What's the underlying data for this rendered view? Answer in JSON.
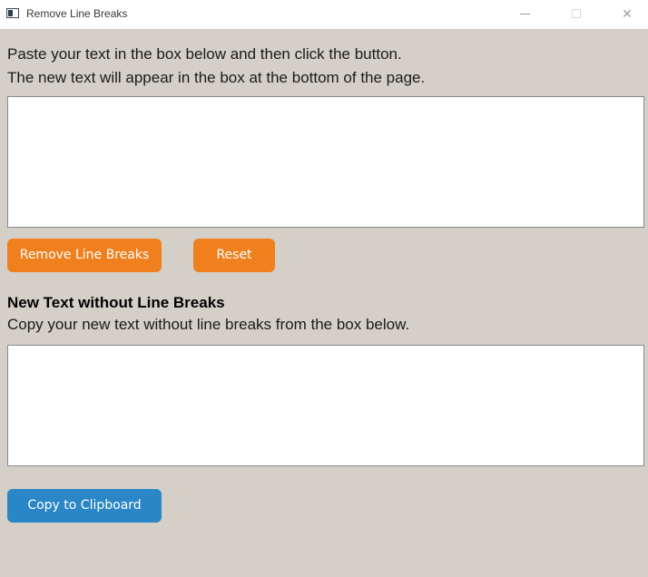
{
  "window": {
    "title": "Remove Line Breaks",
    "minimize_glyph": "",
    "close_glyph": "✕"
  },
  "instructions": {
    "line1": "Paste your text in the box below and then click the button.",
    "line2": "The new text will appear in the box at the bottom of the page."
  },
  "input_box": {
    "value": "",
    "placeholder": ""
  },
  "buttons": {
    "remove_label": "Remove Line Breaks",
    "reset_label": "Reset",
    "copy_label": "Copy to Clipboard"
  },
  "output_section": {
    "heading": "New Text without Line Breaks",
    "subtext": "Copy your new text without line breaks from the box below."
  },
  "output_box": {
    "value": "",
    "placeholder": ""
  },
  "colors": {
    "background": "#d4d0c8",
    "action_button": "#f0801e",
    "copy_button": "#2a86c6"
  }
}
